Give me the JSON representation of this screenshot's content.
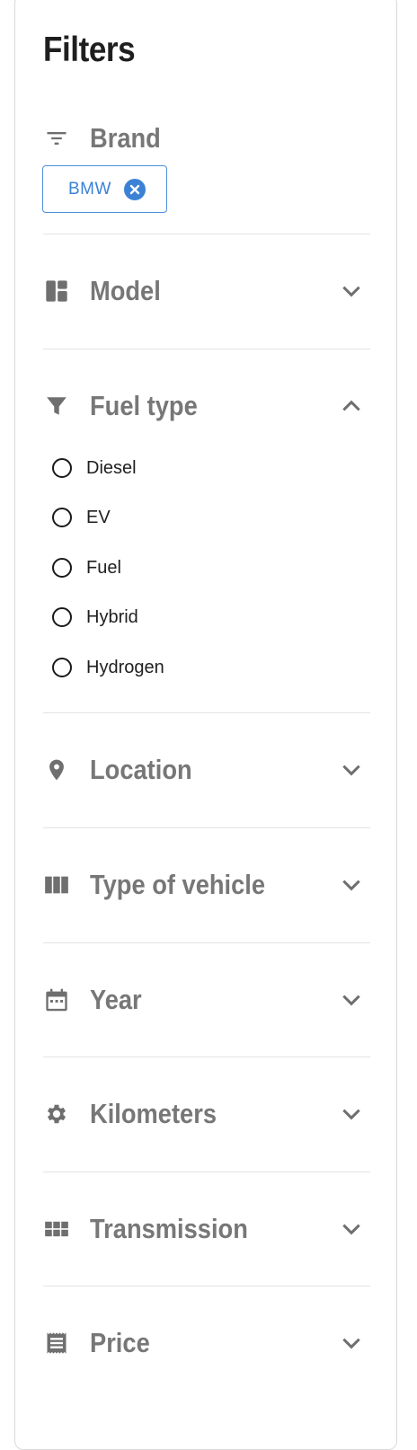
{
  "filters": {
    "title": "Filters",
    "brand": {
      "label": "Brand",
      "icon": "filter-list-icon",
      "chip": {
        "label": "BMW",
        "remove_icon": "close-circle-icon",
        "color": "#3b82d6"
      }
    },
    "sections": [
      {
        "label": "Model",
        "icon": "dashboard-icon",
        "expanded": false
      },
      {
        "label": "Fuel type",
        "icon": "funnel-icon",
        "expanded": true
      },
      {
        "label": "Location",
        "icon": "location-pin-icon",
        "expanded": false
      },
      {
        "label": "Type of vehicle",
        "icon": "columns-icon",
        "expanded": false
      },
      {
        "label": "Year",
        "icon": "calendar-icon",
        "expanded": false
      },
      {
        "label": "Kilometers",
        "icon": "gear-icon",
        "expanded": false
      },
      {
        "label": "Transmission",
        "icon": "apps-grid-icon",
        "expanded": false
      },
      {
        "label": "Price",
        "icon": "receipt-icon",
        "expanded": false
      }
    ],
    "fuel_options": [
      {
        "label": "Diesel",
        "selected": false
      },
      {
        "label": "EV",
        "selected": false
      },
      {
        "label": "Fuel",
        "selected": false
      },
      {
        "label": "Hybrid",
        "selected": false
      },
      {
        "label": "Hydrogen",
        "selected": false
      }
    ]
  }
}
